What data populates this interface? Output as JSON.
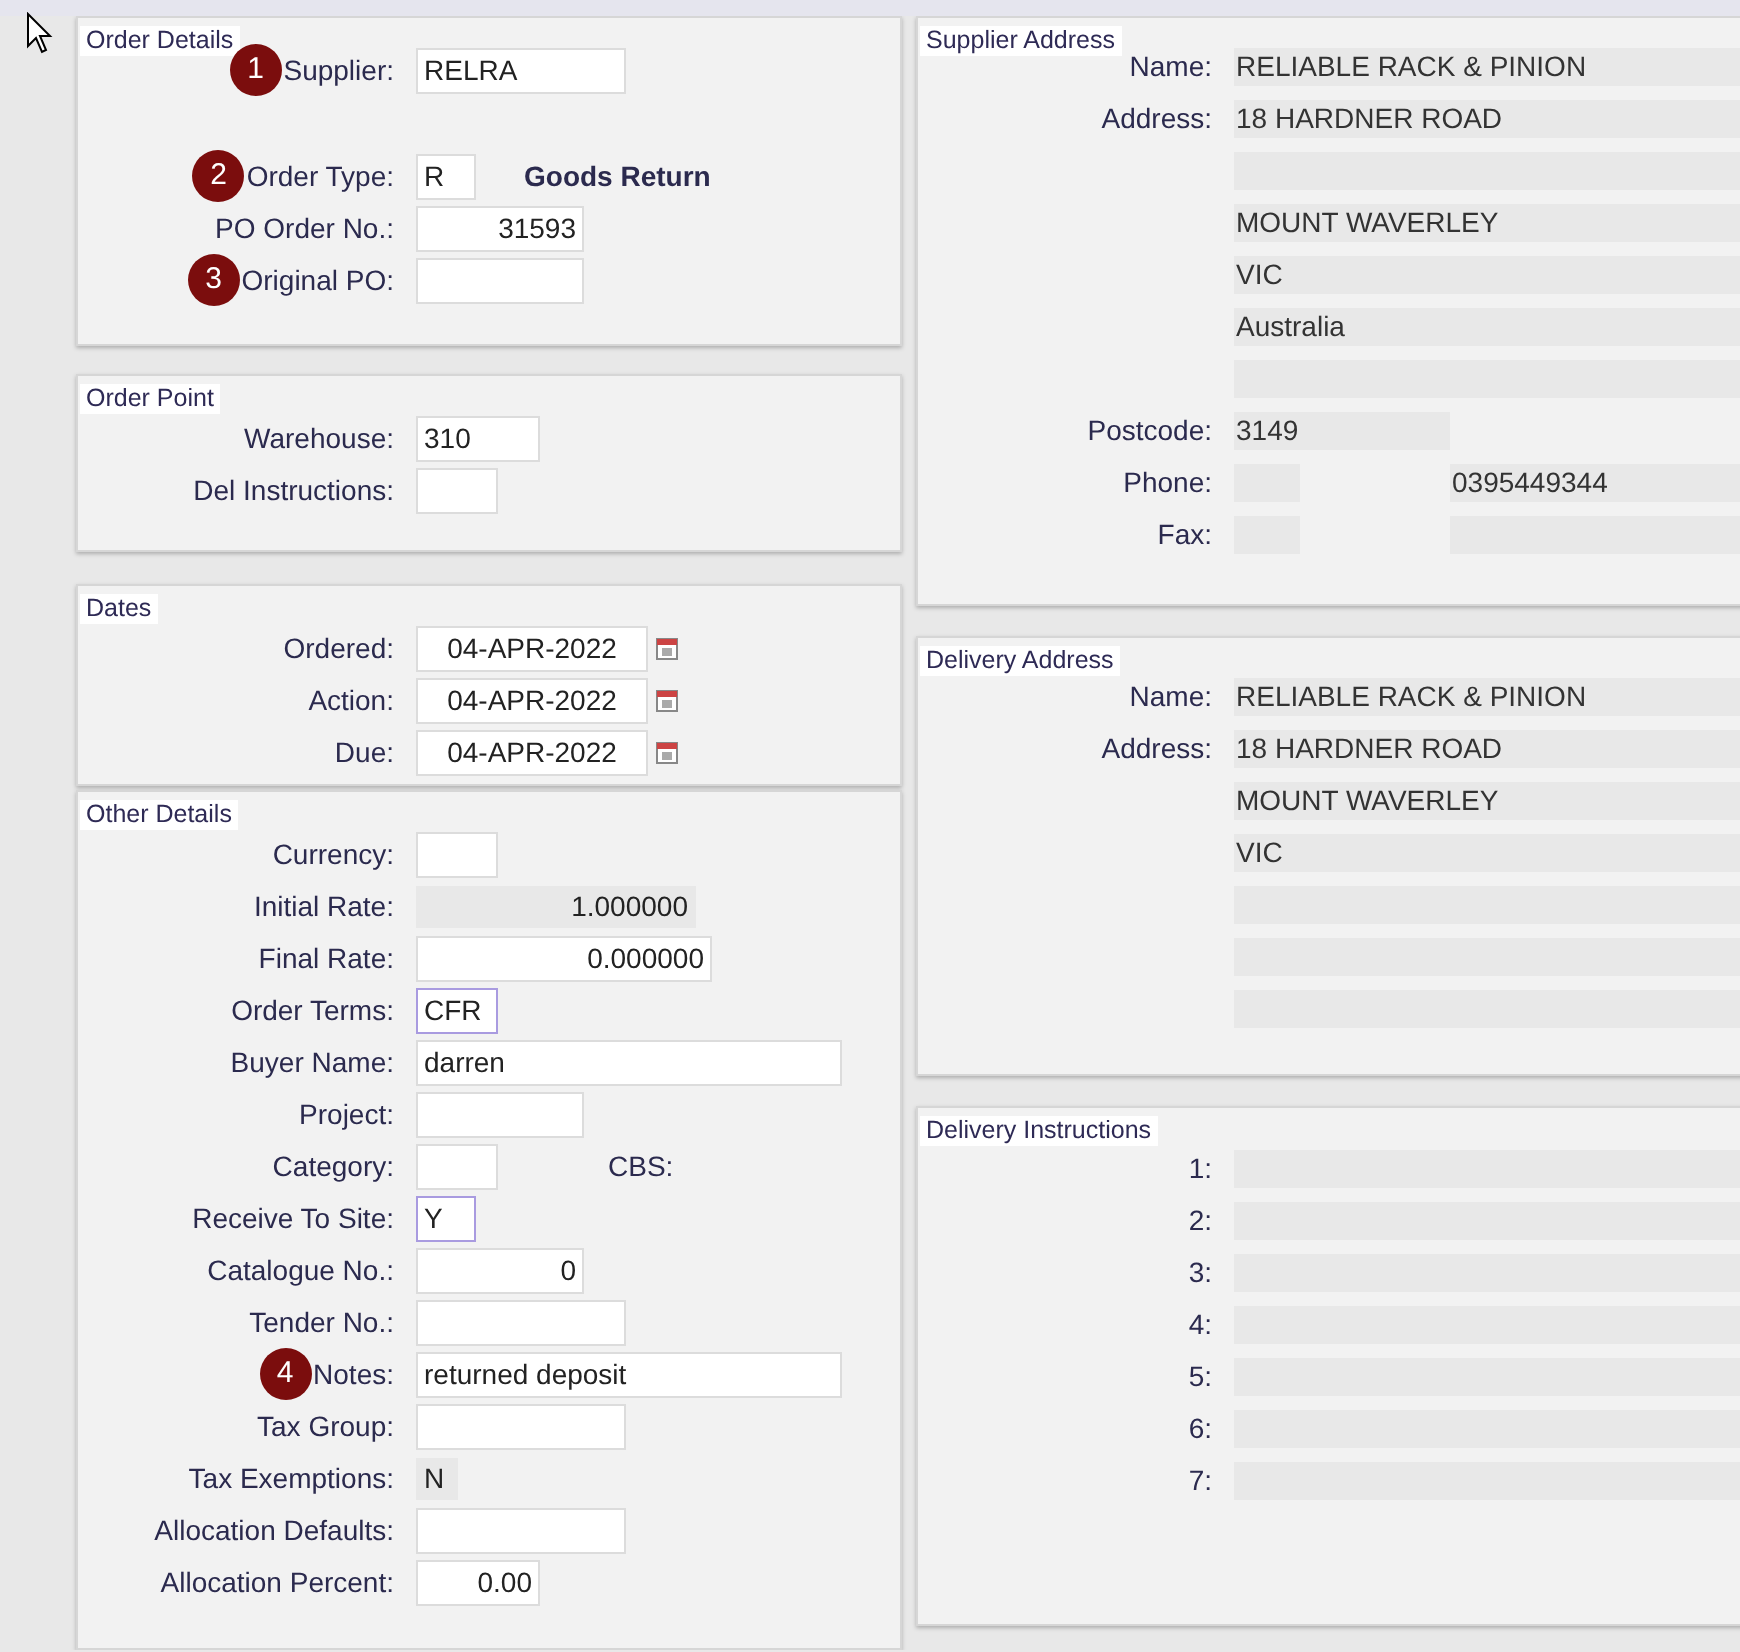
{
  "left_sections": [
    {
      "title": "Order Details",
      "fields": [
        {
          "label": "Supplier:",
          "marker": "1",
          "kind": "text",
          "value": "RELRA"
        },
        {
          "label": "Order Type:",
          "marker": "2",
          "kind": "text",
          "value": "R",
          "note": {
            "text": "Goods Return",
            "emphasis": true
          }
        },
        {
          "label": "PO Order No.:",
          "kind": "number",
          "value": "31593"
        },
        {
          "label": "Original PO:",
          "marker": "3",
          "kind": "text"
        }
      ]
    },
    {
      "title": "Order Point",
      "fields": [
        {
          "label": "Warehouse:",
          "kind": "text",
          "value": "310"
        },
        {
          "label": "Del Instructions:",
          "kind": "text"
        }
      ]
    },
    {
      "title": "Dates",
      "fields": [
        {
          "label": "Ordered:",
          "kind": "date",
          "value": "04-APR-2022"
        },
        {
          "label": "Action:",
          "kind": "date",
          "value": "04-APR-2022"
        },
        {
          "label": "Due:",
          "kind": "date",
          "value": "04-APR-2022"
        }
      ]
    },
    {
      "title": "Other Details",
      "fields": [
        {
          "label": "Currency:",
          "kind": "text"
        },
        {
          "label": "Initial Rate:",
          "kind": "rate",
          "value": "1.000000"
        },
        {
          "label": "Final Rate:",
          "kind": "number",
          "value": "0.000000"
        },
        {
          "label": "Order Terms:",
          "kind": "text",
          "value": "CFR",
          "highlighted": true
        },
        {
          "label": "Buyer Name:",
          "kind": "text",
          "value": "darren"
        },
        {
          "label": "Project:",
          "kind": "text"
        },
        {
          "label": "Category:",
          "kind": "text",
          "note": {
            "text": "CBS:",
            "emphasis": false
          }
        },
        {
          "label": "Receive To Site:",
          "kind": "text",
          "value": "Y",
          "highlighted": true
        },
        {
          "label": "Catalogue No.:",
          "kind": "number",
          "value": "0"
        },
        {
          "label": "Tender No.:",
          "kind": "text"
        },
        {
          "label": "Notes:",
          "marker": "4",
          "kind": "text",
          "value": "returned deposit"
        },
        {
          "label": "Tax Group:",
          "kind": "text"
        },
        {
          "label": "Tax Exemptions:",
          "kind": "flag",
          "value": "N"
        },
        {
          "label": "Allocation Defaults:",
          "kind": "text"
        },
        {
          "label": "Allocation Percent:",
          "kind": "number",
          "value": "0.00"
        }
      ]
    }
  ],
  "right_sections": [
    {
      "title": "Supplier Address",
      "rows": [
        {
          "label": "Name:",
          "kind": "line",
          "value": "RELIABLE RACK & PINION"
        },
        {
          "label": "Address:",
          "kind": "line",
          "value": "18 HARDNER ROAD"
        },
        {
          "kind": "line"
        },
        {
          "kind": "line",
          "value": "MOUNT WAVERLEY"
        },
        {
          "kind": "line",
          "value": "VIC"
        },
        {
          "kind": "line",
          "value": "Australia"
        },
        {
          "kind": "line"
        },
        {
          "label": "Postcode:",
          "kind": "short",
          "value": "3149"
        },
        {
          "label": "Phone:",
          "kind": "split",
          "value": "0395449344"
        },
        {
          "label": "Fax:",
          "kind": "split"
        }
      ]
    },
    {
      "title": "Delivery Address",
      "rows": [
        {
          "label": "Name:",
          "kind": "line",
          "value": "RELIABLE RACK & PINION"
        },
        {
          "label": "Address:",
          "kind": "line",
          "value": "18 HARDNER ROAD"
        },
        {
          "kind": "line",
          "value": "MOUNT WAVERLEY"
        },
        {
          "kind": "line",
          "value": "VIC"
        },
        {
          "kind": "line"
        },
        {
          "kind": "line"
        },
        {
          "kind": "line"
        }
      ]
    },
    {
      "title": "Delivery Instructions",
      "rows": [
        {
          "label": "1:",
          "kind": "line"
        },
        {
          "label": "2:",
          "kind": "line"
        },
        {
          "label": "3:",
          "kind": "line"
        },
        {
          "label": "4:",
          "kind": "line"
        },
        {
          "label": "5:",
          "kind": "line"
        },
        {
          "label": "6:",
          "kind": "line"
        },
        {
          "label": "7:",
          "kind": "line"
        }
      ]
    }
  ]
}
